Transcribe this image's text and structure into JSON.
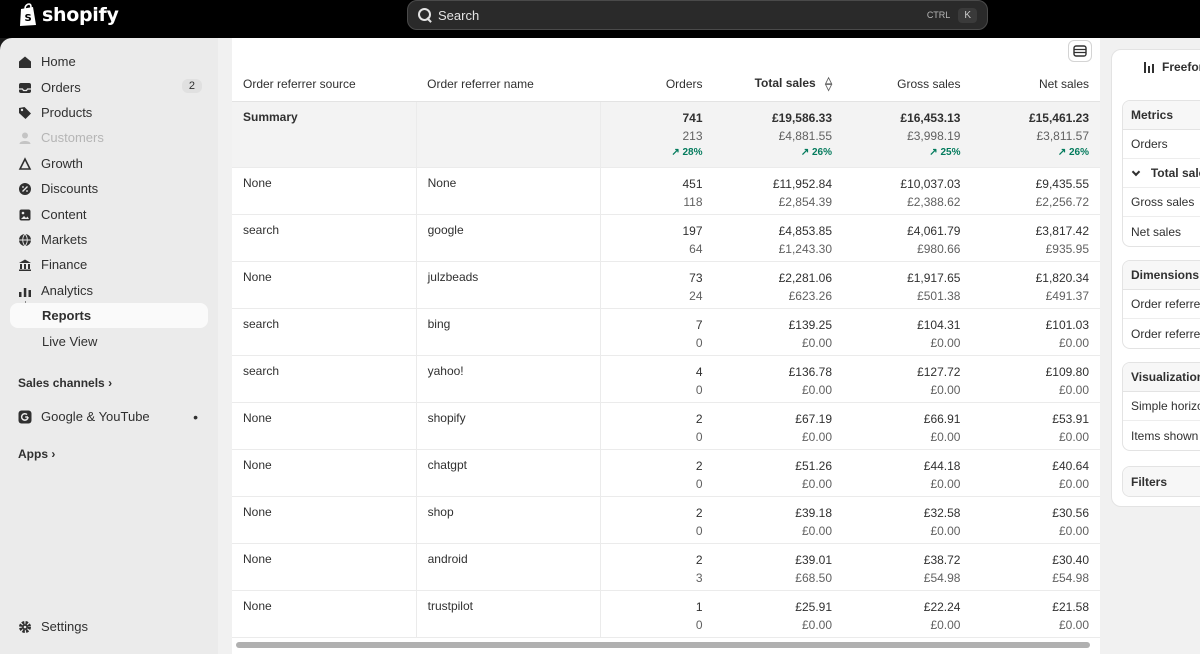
{
  "topbar": {
    "brand": "shopify",
    "search_placeholder": "Search",
    "shortcut_mod": "CTRL",
    "shortcut_key": "K"
  },
  "sidebar": {
    "items": [
      {
        "label": "Home"
      },
      {
        "label": "Orders",
        "badge": "2"
      },
      {
        "label": "Products"
      },
      {
        "label": "Customers"
      },
      {
        "label": "Growth"
      },
      {
        "label": "Discounts"
      },
      {
        "label": "Content"
      },
      {
        "label": "Markets"
      },
      {
        "label": "Finance"
      },
      {
        "label": "Analytics"
      },
      {
        "label": "Reports"
      },
      {
        "label": "Live View"
      }
    ],
    "sales_channels_label": "Sales channels",
    "google_youtube_label": "Google & YouTube",
    "apps_label": "Apps",
    "settings_label": "Settings"
  },
  "table": {
    "columns": [
      "Order referrer source",
      "Order referrer name",
      "Orders",
      "Total sales",
      "Gross sales",
      "Net sales"
    ],
    "summary": {
      "label": "Summary",
      "orders": [
        "741",
        "213",
        "28%"
      ],
      "total_sales": [
        "£19,586.33",
        "£4,881.55",
        "26%"
      ],
      "gross_sales": [
        "£16,453.13",
        "£3,998.19",
        "25%"
      ],
      "net_sales": [
        "£15,461.23",
        "£3,811.57",
        "26%"
      ]
    },
    "rows": [
      {
        "source": "None",
        "name": "None",
        "orders": [
          "451",
          "118"
        ],
        "total": [
          "£11,952.84",
          "£2,854.39"
        ],
        "gross": [
          "£10,037.03",
          "£2,388.62"
        ],
        "net": [
          "£9,435.55",
          "£2,256.72"
        ]
      },
      {
        "source": "search",
        "name": "google",
        "orders": [
          "197",
          "64"
        ],
        "total": [
          "£4,853.85",
          "£1,243.30"
        ],
        "gross": [
          "£4,061.79",
          "£980.66"
        ],
        "net": [
          "£3,817.42",
          "£935.95"
        ]
      },
      {
        "source": "None",
        "name": "julzbeads",
        "orders": [
          "73",
          "24"
        ],
        "total": [
          "£2,281.06",
          "£623.26"
        ],
        "gross": [
          "£1,917.65",
          "£501.38"
        ],
        "net": [
          "£1,820.34",
          "£491.37"
        ]
      },
      {
        "source": "search",
        "name": "bing",
        "orders": [
          "7",
          "0"
        ],
        "total": [
          "£139.25",
          "£0.00"
        ],
        "gross": [
          "£104.31",
          "£0.00"
        ],
        "net": [
          "£101.03",
          "£0.00"
        ]
      },
      {
        "source": "search",
        "name": "yahoo!",
        "orders": [
          "4",
          "0"
        ],
        "total": [
          "£136.78",
          "£0.00"
        ],
        "gross": [
          "£127.72",
          "£0.00"
        ],
        "net": [
          "£109.80",
          "£0.00"
        ]
      },
      {
        "source": "None",
        "name": "shopify",
        "orders": [
          "2",
          "0"
        ],
        "total": [
          "£67.19",
          "£0.00"
        ],
        "gross": [
          "£66.91",
          "£0.00"
        ],
        "net": [
          "£53.91",
          "£0.00"
        ]
      },
      {
        "source": "None",
        "name": "chatgpt",
        "orders": [
          "2",
          "0"
        ],
        "total": [
          "£51.26",
          "£0.00"
        ],
        "gross": [
          "£44.18",
          "£0.00"
        ],
        "net": [
          "£40.64",
          "£0.00"
        ]
      },
      {
        "source": "None",
        "name": "shop",
        "orders": [
          "2",
          "0"
        ],
        "total": [
          "£39.18",
          "£0.00"
        ],
        "gross": [
          "£32.58",
          "£0.00"
        ],
        "net": [
          "£30.56",
          "£0.00"
        ]
      },
      {
        "source": "None",
        "name": "android",
        "orders": [
          "2",
          "3"
        ],
        "total": [
          "£39.01",
          "£68.50"
        ],
        "gross": [
          "£38.72",
          "£54.98"
        ],
        "net": [
          "£30.40",
          "£54.98"
        ]
      },
      {
        "source": "None",
        "name": "trustpilot",
        "orders": [
          "1",
          "0"
        ],
        "total": [
          "£25.91",
          "£0.00"
        ],
        "gross": [
          "£22.24",
          "£0.00"
        ],
        "net": [
          "£21.58",
          "£0.00"
        ]
      }
    ]
  },
  "config": {
    "header": "Freeform",
    "metrics_title": "Metrics",
    "metrics": [
      "Orders",
      "Total sales",
      "Gross sales",
      "Net sales"
    ],
    "dimensions_title": "Dimensions",
    "dimensions": [
      "Order referrer source",
      "Order referrer name"
    ],
    "visualization_title": "Visualization",
    "visualization": [
      "Simple horizontal",
      "Items shown"
    ],
    "filters_title": "Filters"
  },
  "colors": {
    "accent_green": "#047b5d",
    "topbar": "#000000",
    "sidebar_bg": "#ebebeb"
  }
}
